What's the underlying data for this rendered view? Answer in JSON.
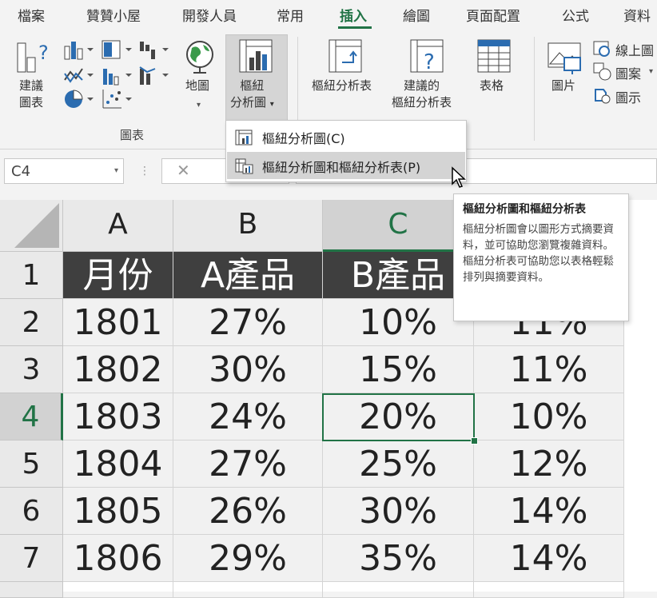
{
  "ribbon_tabs": [
    "檔案",
    "贊贊小屋",
    "開發人員",
    "常用",
    "插入",
    "繪圖",
    "頁面配置",
    "公式",
    "資料"
  ],
  "ribbon": {
    "recommended_charts": [
      "建議",
      "圖表"
    ],
    "maps": "地圖",
    "pivot_chart": [
      "樞紐",
      "分析圖"
    ],
    "pivot_table": "樞紐分析表",
    "recommended_pivot": [
      "建議的",
      "樞紐分析表"
    ],
    "table": "表格",
    "picture": "圖片",
    "online_pictures": "線上圖",
    "shapes": "圖案",
    "icons": "圖示",
    "charts_group": "圖表"
  },
  "dropdown_menu": {
    "items": [
      "樞紐分析圖(C)",
      "樞紐分析圖和樞紐分析表(P)"
    ]
  },
  "formula_bar": {
    "name_box": "C4",
    "cancel": "✕"
  },
  "tooltip": {
    "title": "樞紐分析圖和樞紐分析表",
    "body": "樞紐分析圖會以圖形方式摘要資料，並可協助您瀏覽複雜資料。樞紐分析表可協助您以表格輕鬆排列與摘要資料。"
  },
  "sheet": {
    "columns": [
      "A",
      "B",
      "C"
    ],
    "rows": [
      "1",
      "2",
      "3",
      "4",
      "5",
      "6",
      "7"
    ],
    "cells": [
      [
        "月份",
        "A產品",
        "B產品",
        ""
      ],
      [
        "1801",
        "27%",
        "10%",
        "11%"
      ],
      [
        "1802",
        "30%",
        "15%",
        "11%"
      ],
      [
        "1803",
        "24%",
        "20%",
        "10%"
      ],
      [
        "1804",
        "27%",
        "25%",
        "12%"
      ],
      [
        "1805",
        "26%",
        "30%",
        "14%"
      ],
      [
        "1806",
        "29%",
        "35%",
        "14%"
      ]
    ]
  },
  "colors": {
    "accent": "#217346",
    "header_fill": "#3f3f3f"
  }
}
